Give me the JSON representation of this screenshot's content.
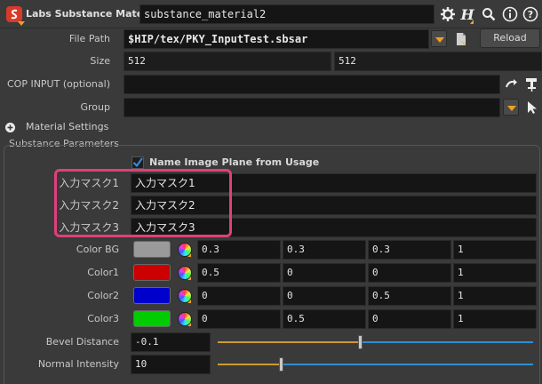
{
  "header": {
    "node_type": "Labs Substance Material",
    "node_name": "substance_material2"
  },
  "file_path": {
    "label": "File Path",
    "value": "$HIP/tex/PKY_InputTest.sbsar",
    "reload_label": "Reload"
  },
  "size": {
    "label": "Size",
    "values": [
      "512",
      "512"
    ]
  },
  "cop_input": {
    "label": "COP INPUT (optional)",
    "value": ""
  },
  "group": {
    "label": "Group",
    "value": ""
  },
  "material_settings": {
    "label": "Material Settings"
  },
  "substance_parameters": {
    "label": "Substance Parameters",
    "name_image_plane": {
      "label": "Name Image Plane from Usage",
      "checked": true
    },
    "masks": [
      {
        "label": "入力マスク1",
        "value": "入力マスク1"
      },
      {
        "label": "入力マスク2",
        "value": "入力マスク2"
      },
      {
        "label": "入力マスク3",
        "value": "入力マスク3"
      }
    ],
    "colors": [
      {
        "label": "Color BG",
        "swatch": "#9a9a9a",
        "values": [
          "0.3",
          "0.3",
          "0.3",
          "1"
        ]
      },
      {
        "label": "Color1",
        "swatch": "#cc0000",
        "values": [
          "0.5",
          "0",
          "0",
          "1"
        ]
      },
      {
        "label": "Color2",
        "swatch": "#0000cc",
        "values": [
          "0",
          "0",
          "0.5",
          "1"
        ]
      },
      {
        "label": "Color3",
        "swatch": "#00cc00",
        "values": [
          "0",
          "0.5",
          "0",
          "1"
        ]
      }
    ],
    "bevel_distance": {
      "label": "Bevel Distance",
      "value": "-0.1",
      "slider_fraction": 0.45
    },
    "normal_intensity": {
      "label": "Normal Intensity",
      "value": "10",
      "slider_fraction": 0.2
    }
  },
  "colors": {
    "accent": "#f0a020",
    "highlight_border": "#e0407a",
    "slider_left": "#d09a30",
    "slider_right": "#2f8fd0",
    "node_icon": "#d83a2a"
  },
  "icons": [
    "substance-node-icon",
    "gear-icon",
    "help-h-icon",
    "search-icon",
    "info-icon",
    "question-icon",
    "file-browse-icon",
    "arrow-pick-icon",
    "pick-tool-icon",
    "cursor-icon",
    "add-icon",
    "checkbox-check-icon",
    "color-wheel-icon"
  ]
}
